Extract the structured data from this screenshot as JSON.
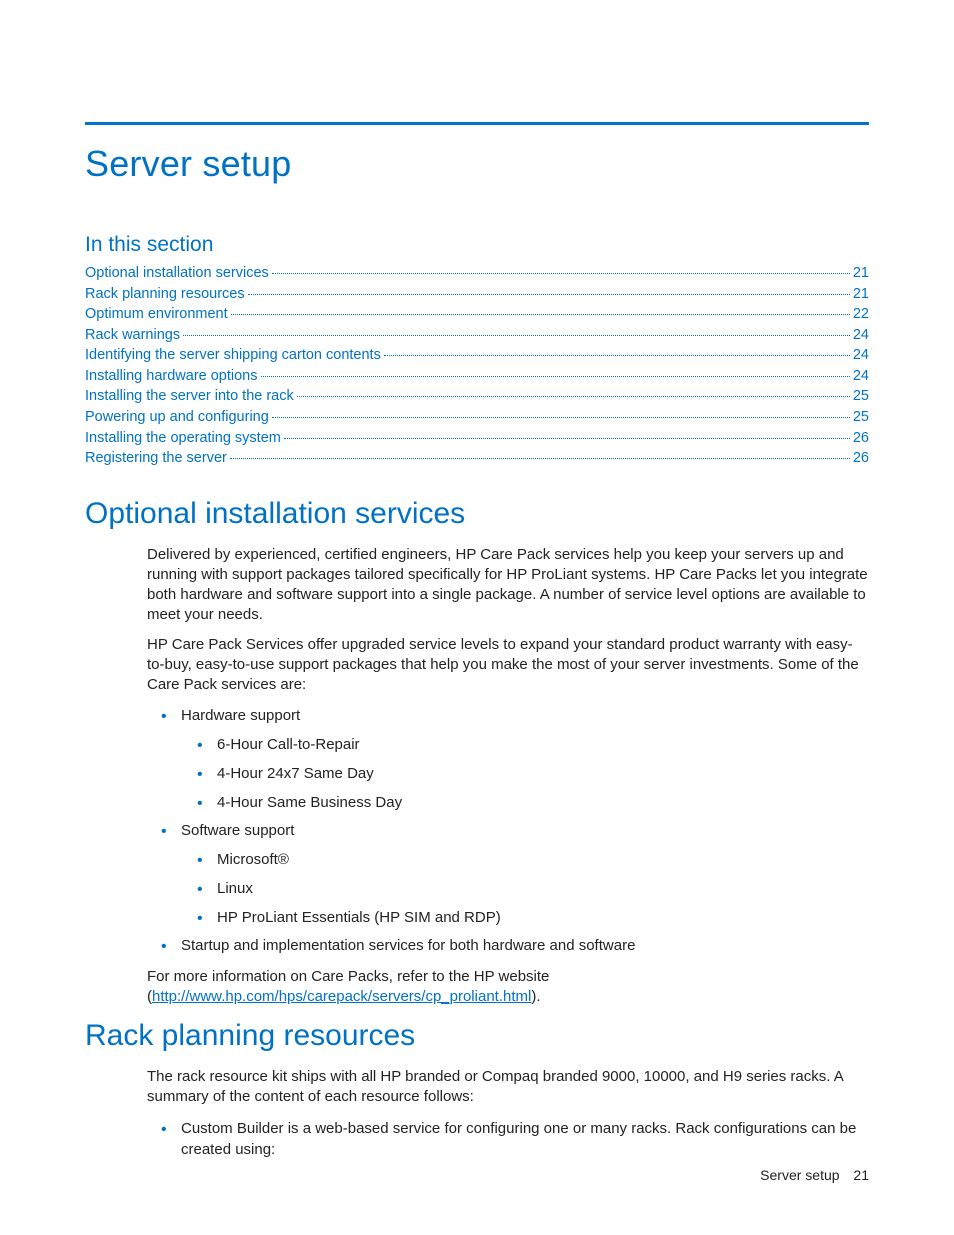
{
  "title": "Server setup",
  "section_label": "In this section",
  "toc": [
    {
      "title": "Optional installation services",
      "page": "21"
    },
    {
      "title": "Rack planning resources",
      "page": "21"
    },
    {
      "title": "Optimum environment",
      "page": "22"
    },
    {
      "title": "Rack warnings",
      "page": "24"
    },
    {
      "title": "Identifying the server shipping carton contents",
      "page": "24"
    },
    {
      "title": "Installing hardware options",
      "page": "24"
    },
    {
      "title": "Installing the server into the rack",
      "page": "25"
    },
    {
      "title": "Powering up and configuring",
      "page": "25"
    },
    {
      "title": "Installing the operating system",
      "page": "26"
    },
    {
      "title": "Registering the server",
      "page": "26"
    }
  ],
  "h_optional": "Optional installation services",
  "p_opt_1": "Delivered by experienced, certified engineers, HP Care Pack services help you keep your servers up and running with support packages tailored specifically for HP ProLiant systems. HP Care Packs let you integrate both hardware and software support into a single package. A number of service level options are available to meet your needs.",
  "p_opt_2": "HP Care Pack Services offer upgraded service levels to expand your standard product warranty with easy-to-buy, easy-to-use support packages that help you make the most of your server investments. Some of the Care Pack services are:",
  "bul": {
    "hw": "Hardware support",
    "hw1": "6-Hour Call-to-Repair",
    "hw2": "4-Hour 24x7 Same Day",
    "hw3": "4-Hour Same Business Day",
    "sw": "Software support",
    "sw1": "Microsoft®",
    "sw2": "Linux",
    "sw3": "HP ProLiant Essentials (HP SIM and RDP)",
    "startup": "Startup and implementation services for both hardware and software"
  },
  "p_opt_3a": "For more information on Care Packs, refer to the HP website (",
  "p_opt_3_link": "http://www.hp.com/hps/carepack/servers/cp_proliant.html",
  "p_opt_3b": ").",
  "h_rack": "Rack planning resources",
  "p_rack_1": "The rack resource kit ships with all HP branded or Compaq branded 9000, 10000, and H9 series racks. A summary of the content of each resource follows:",
  "bul_rack_1": "Custom Builder is a web-based service for configuring one or many racks. Rack configurations can be created using:",
  "footer": {
    "section": "Server setup",
    "page": "21"
  }
}
